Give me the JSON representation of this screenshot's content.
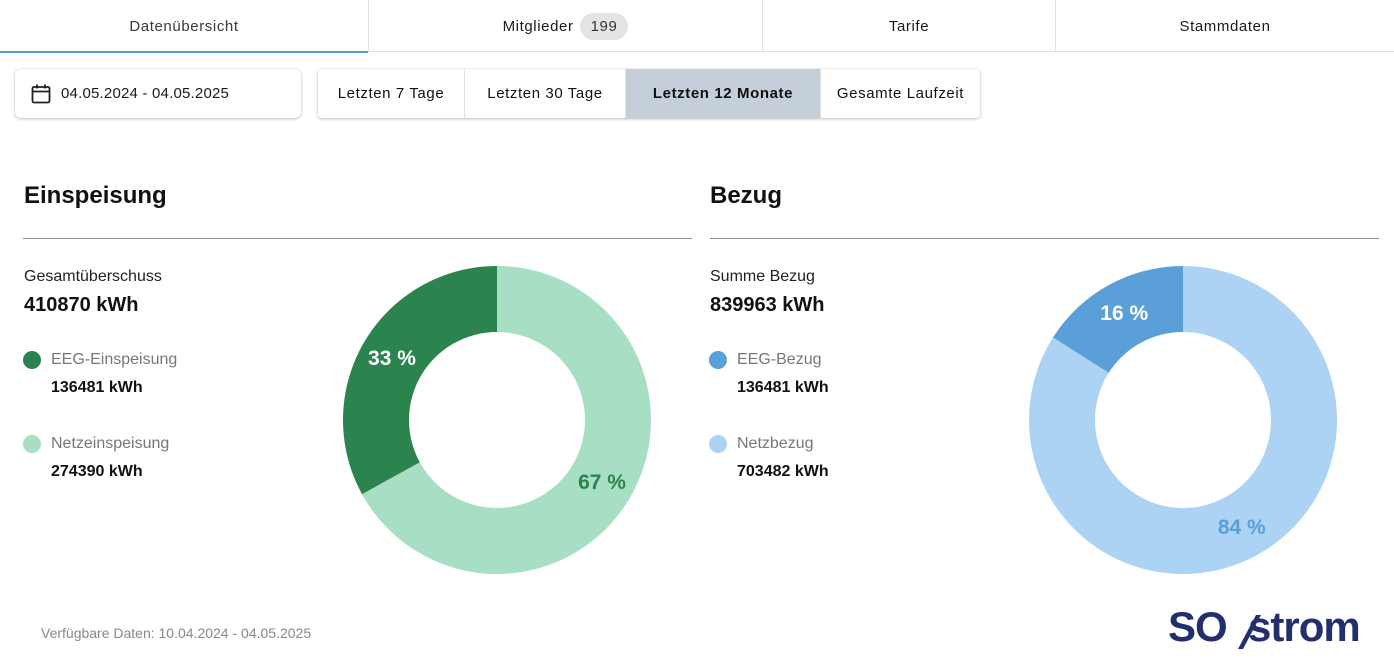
{
  "tabs": [
    {
      "label": "Datenübersicht"
    },
    {
      "label": "Mitglieder",
      "badge": "199"
    },
    {
      "label": "Tarife"
    },
    {
      "label": "Stammdaten"
    }
  ],
  "date_range": {
    "value": "04.05.2024 - 04.05.2025",
    "icon": "calendar-icon"
  },
  "range_buttons": [
    {
      "label": "Letzten 7 Tage"
    },
    {
      "label": "Letzten 30 Tage"
    },
    {
      "label": "Letzten 12 Monate",
      "selected": true
    },
    {
      "label": "Gesamte Laufzeit"
    }
  ],
  "einspeisung": {
    "title": "Einspeisung",
    "total_label": "Gesamtüberschuss",
    "total_value": "410870 kWh",
    "items": [
      {
        "label": "EEG-Einspeisung",
        "value": "136481 kWh",
        "color": "#2b844e"
      },
      {
        "label": "Netzeinspeisung",
        "value": "274390 kWh",
        "color": "#a8dec3"
      }
    ],
    "pct_labels": [
      "33 %",
      "67 %"
    ]
  },
  "bezug": {
    "title": "Bezug",
    "total_label": "Summe Bezug",
    "total_value": "839963 kWh",
    "items": [
      {
        "label": "EEG-Bezug",
        "value": "136481 kWh",
        "color": "#5b9fd8"
      },
      {
        "label": "Netzbezug",
        "value": "703482 kWh",
        "color": "#acd3f3"
      }
    ],
    "pct_labels": [
      "16 %",
      "84 %"
    ]
  },
  "chart_data": [
    {
      "type": "pie",
      "categories": [
        "EEG-Einspeisung",
        "Netzeinspeisung"
      ],
      "values": [
        33,
        67
      ],
      "colors": [
        "#2b844e",
        "#a8dec3"
      ]
    },
    {
      "type": "pie",
      "categories": [
        "EEG-Bezug",
        "Netzbezug"
      ],
      "values": [
        16,
        84
      ],
      "colors": [
        "#5b9fd8",
        "#acd3f3"
      ]
    }
  ],
  "footer": {
    "available": "Verfügbare Daten: 10.04.2024 - 04.05.2025"
  },
  "logo": {
    "text": "SO/strom",
    "color": "#232e6e"
  }
}
